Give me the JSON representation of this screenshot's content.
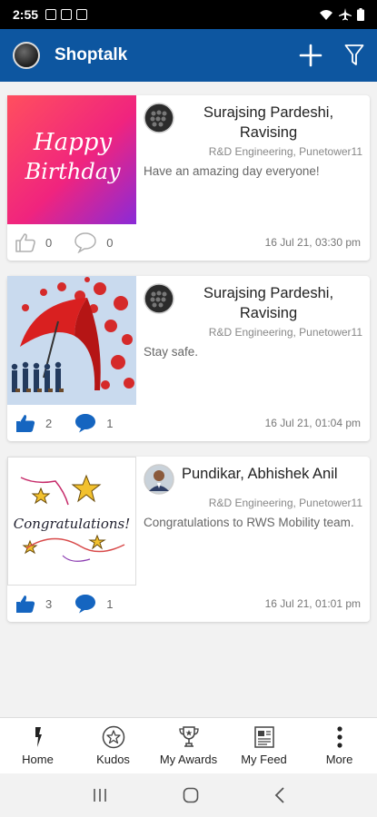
{
  "status_bar": {
    "time": "2:55"
  },
  "app_bar": {
    "title": "Shoptalk"
  },
  "posts": [
    {
      "author": "Surajsing Pardeshi, Ravising",
      "department": "R&D Engineering, Punetower11",
      "message": "Have an amazing day everyone!",
      "image_text": [
        "Happy",
        "Birthday"
      ],
      "likes": "0",
      "comments": "0",
      "timestamp": "16 Jul 21, 03:30 pm",
      "liked": false
    },
    {
      "author": "Surajsing Pardeshi, Ravising",
      "department": "R&D Engineering, Punetower11",
      "message": "Stay safe.",
      "likes": "2",
      "comments": "1",
      "timestamp": "16 Jul 21, 01:04 pm",
      "liked": true
    },
    {
      "author": "Pundikar, Abhishek Anil",
      "department": "R&D Engineering, Punetower11",
      "message": "Congratulations to RWS Mobility team.",
      "image_text": "Congratulations!",
      "likes": "3",
      "comments": "1",
      "timestamp": "16 Jul 21, 01:01 pm",
      "liked": true
    }
  ],
  "bottom_nav": [
    {
      "label": "Home",
      "icon": "home-icon"
    },
    {
      "label": "Kudos",
      "icon": "star-badge-icon"
    },
    {
      "label": "My Awards",
      "icon": "trophy-icon"
    },
    {
      "label": "My Feed",
      "icon": "feed-icon"
    },
    {
      "label": "More",
      "icon": "more-vertical-icon"
    }
  ],
  "colors": {
    "primary": "#0d56a0",
    "like_active": "#1565c0",
    "like_inactive": "#b0b0b0"
  }
}
